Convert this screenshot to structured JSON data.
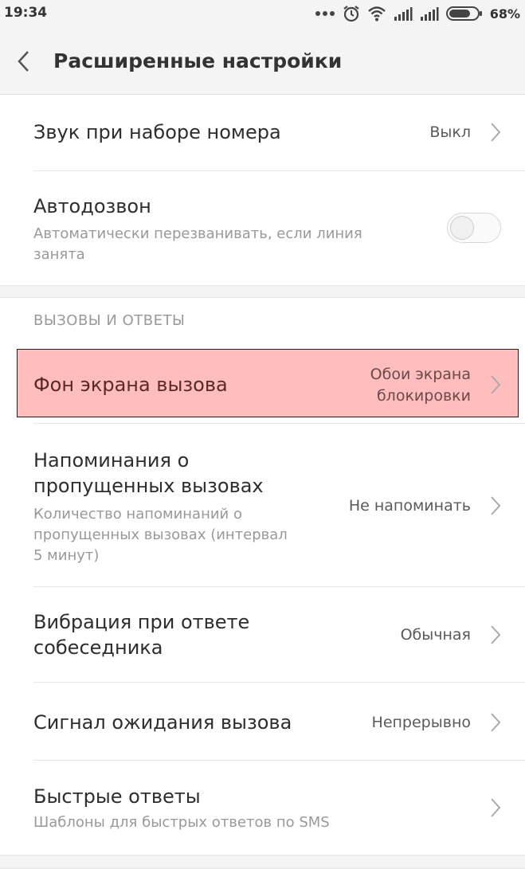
{
  "status_bar": {
    "time": "19:34",
    "battery_percent": "68%",
    "icons": [
      "dots-icon",
      "alarm-icon",
      "wifi-icon",
      "signal-icon",
      "signal-icon",
      "battery-icon"
    ]
  },
  "header": {
    "title": "Расширенные настройки",
    "back_icon": "back-arrow-icon"
  },
  "rows": {
    "dial_sound": {
      "label": "Звук при наборе номера",
      "value": "Выкл"
    },
    "auto_redial": {
      "label": "Автодозвон",
      "description_line1": "Автоматически перезванивать, если линия",
      "description_line2": "занята",
      "toggle_on": false
    }
  },
  "section_calls": {
    "title": "ВЫЗОВЫ И ОТВЕТЫ",
    "items": {
      "call_background": {
        "label": "Фон экрана вызова",
        "value_line1": "Обои экрана",
        "value_line2": "блокировки",
        "highlight_color": "#ffbdbe"
      },
      "missed_reminders": {
        "label_line1": "Напоминания о",
        "label_line2": "пропущенных вызовах",
        "description_line1": "Количество напоминаний о",
        "description_line2": "пропущенных вызовах (интервал",
        "description_line3": "5 минут)",
        "value": "Не напоминать"
      },
      "answer_vibration": {
        "label_line1": "Вибрация при ответе",
        "label_line2": "собеседника",
        "value": "Обычная"
      },
      "call_waiting": {
        "label": "Сигнал ожидания вызова",
        "value": "Непрерывно"
      },
      "quick_replies": {
        "label": "Быстрые ответы",
        "description": "Шаблоны для быстрых ответов по SMS"
      }
    }
  }
}
